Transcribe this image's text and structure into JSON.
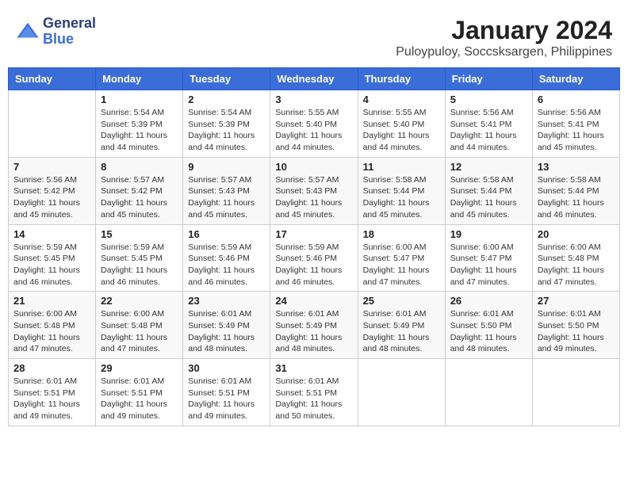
{
  "header": {
    "logo_general": "General",
    "logo_blue": "Blue",
    "title": "January 2024",
    "subtitle": "Puloypuloy, Soccsksargen, Philippines"
  },
  "days_of_week": [
    "Sunday",
    "Monday",
    "Tuesday",
    "Wednesday",
    "Thursday",
    "Friday",
    "Saturday"
  ],
  "weeks": [
    [
      {
        "day": "",
        "sunrise": "",
        "sunset": "",
        "daylight": ""
      },
      {
        "day": "1",
        "sunrise": "Sunrise: 5:54 AM",
        "sunset": "Sunset: 5:39 PM",
        "daylight": "Daylight: 11 hours and 44 minutes."
      },
      {
        "day": "2",
        "sunrise": "Sunrise: 5:54 AM",
        "sunset": "Sunset: 5:39 PM",
        "daylight": "Daylight: 11 hours and 44 minutes."
      },
      {
        "day": "3",
        "sunrise": "Sunrise: 5:55 AM",
        "sunset": "Sunset: 5:40 PM",
        "daylight": "Daylight: 11 hours and 44 minutes."
      },
      {
        "day": "4",
        "sunrise": "Sunrise: 5:55 AM",
        "sunset": "Sunset: 5:40 PM",
        "daylight": "Daylight: 11 hours and 44 minutes."
      },
      {
        "day": "5",
        "sunrise": "Sunrise: 5:56 AM",
        "sunset": "Sunset: 5:41 PM",
        "daylight": "Daylight: 11 hours and 44 minutes."
      },
      {
        "day": "6",
        "sunrise": "Sunrise: 5:56 AM",
        "sunset": "Sunset: 5:41 PM",
        "daylight": "Daylight: 11 hours and 45 minutes."
      }
    ],
    [
      {
        "day": "7",
        "sunrise": "Sunrise: 5:56 AM",
        "sunset": "Sunset: 5:42 PM",
        "daylight": "Daylight: 11 hours and 45 minutes."
      },
      {
        "day": "8",
        "sunrise": "Sunrise: 5:57 AM",
        "sunset": "Sunset: 5:42 PM",
        "daylight": "Daylight: 11 hours and 45 minutes."
      },
      {
        "day": "9",
        "sunrise": "Sunrise: 5:57 AM",
        "sunset": "Sunset: 5:43 PM",
        "daylight": "Daylight: 11 hours and 45 minutes."
      },
      {
        "day": "10",
        "sunrise": "Sunrise: 5:57 AM",
        "sunset": "Sunset: 5:43 PM",
        "daylight": "Daylight: 11 hours and 45 minutes."
      },
      {
        "day": "11",
        "sunrise": "Sunrise: 5:58 AM",
        "sunset": "Sunset: 5:44 PM",
        "daylight": "Daylight: 11 hours and 45 minutes."
      },
      {
        "day": "12",
        "sunrise": "Sunrise: 5:58 AM",
        "sunset": "Sunset: 5:44 PM",
        "daylight": "Daylight: 11 hours and 45 minutes."
      },
      {
        "day": "13",
        "sunrise": "Sunrise: 5:58 AM",
        "sunset": "Sunset: 5:44 PM",
        "daylight": "Daylight: 11 hours and 46 minutes."
      }
    ],
    [
      {
        "day": "14",
        "sunrise": "Sunrise: 5:59 AM",
        "sunset": "Sunset: 5:45 PM",
        "daylight": "Daylight: 11 hours and 46 minutes."
      },
      {
        "day": "15",
        "sunrise": "Sunrise: 5:59 AM",
        "sunset": "Sunset: 5:45 PM",
        "daylight": "Daylight: 11 hours and 46 minutes."
      },
      {
        "day": "16",
        "sunrise": "Sunrise: 5:59 AM",
        "sunset": "Sunset: 5:46 PM",
        "daylight": "Daylight: 11 hours and 46 minutes."
      },
      {
        "day": "17",
        "sunrise": "Sunrise: 5:59 AM",
        "sunset": "Sunset: 5:46 PM",
        "daylight": "Daylight: 11 hours and 46 minutes."
      },
      {
        "day": "18",
        "sunrise": "Sunrise: 6:00 AM",
        "sunset": "Sunset: 5:47 PM",
        "daylight": "Daylight: 11 hours and 47 minutes."
      },
      {
        "day": "19",
        "sunrise": "Sunrise: 6:00 AM",
        "sunset": "Sunset: 5:47 PM",
        "daylight": "Daylight: 11 hours and 47 minutes."
      },
      {
        "day": "20",
        "sunrise": "Sunrise: 6:00 AM",
        "sunset": "Sunset: 5:48 PM",
        "daylight": "Daylight: 11 hours and 47 minutes."
      }
    ],
    [
      {
        "day": "21",
        "sunrise": "Sunrise: 6:00 AM",
        "sunset": "Sunset: 5:48 PM",
        "daylight": "Daylight: 11 hours and 47 minutes."
      },
      {
        "day": "22",
        "sunrise": "Sunrise: 6:00 AM",
        "sunset": "Sunset: 5:48 PM",
        "daylight": "Daylight: 11 hours and 47 minutes."
      },
      {
        "day": "23",
        "sunrise": "Sunrise: 6:01 AM",
        "sunset": "Sunset: 5:49 PM",
        "daylight": "Daylight: 11 hours and 48 minutes."
      },
      {
        "day": "24",
        "sunrise": "Sunrise: 6:01 AM",
        "sunset": "Sunset: 5:49 PM",
        "daylight": "Daylight: 11 hours and 48 minutes."
      },
      {
        "day": "25",
        "sunrise": "Sunrise: 6:01 AM",
        "sunset": "Sunset: 5:49 PM",
        "daylight": "Daylight: 11 hours and 48 minutes."
      },
      {
        "day": "26",
        "sunrise": "Sunrise: 6:01 AM",
        "sunset": "Sunset: 5:50 PM",
        "daylight": "Daylight: 11 hours and 48 minutes."
      },
      {
        "day": "27",
        "sunrise": "Sunrise: 6:01 AM",
        "sunset": "Sunset: 5:50 PM",
        "daylight": "Daylight: 11 hours and 49 minutes."
      }
    ],
    [
      {
        "day": "28",
        "sunrise": "Sunrise: 6:01 AM",
        "sunset": "Sunset: 5:51 PM",
        "daylight": "Daylight: 11 hours and 49 minutes."
      },
      {
        "day": "29",
        "sunrise": "Sunrise: 6:01 AM",
        "sunset": "Sunset: 5:51 PM",
        "daylight": "Daylight: 11 hours and 49 minutes."
      },
      {
        "day": "30",
        "sunrise": "Sunrise: 6:01 AM",
        "sunset": "Sunset: 5:51 PM",
        "daylight": "Daylight: 11 hours and 49 minutes."
      },
      {
        "day": "31",
        "sunrise": "Sunrise: 6:01 AM",
        "sunset": "Sunset: 5:51 PM",
        "daylight": "Daylight: 11 hours and 50 minutes."
      },
      {
        "day": "",
        "sunrise": "",
        "sunset": "",
        "daylight": ""
      },
      {
        "day": "",
        "sunrise": "",
        "sunset": "",
        "daylight": ""
      },
      {
        "day": "",
        "sunrise": "",
        "sunset": "",
        "daylight": ""
      }
    ]
  ]
}
